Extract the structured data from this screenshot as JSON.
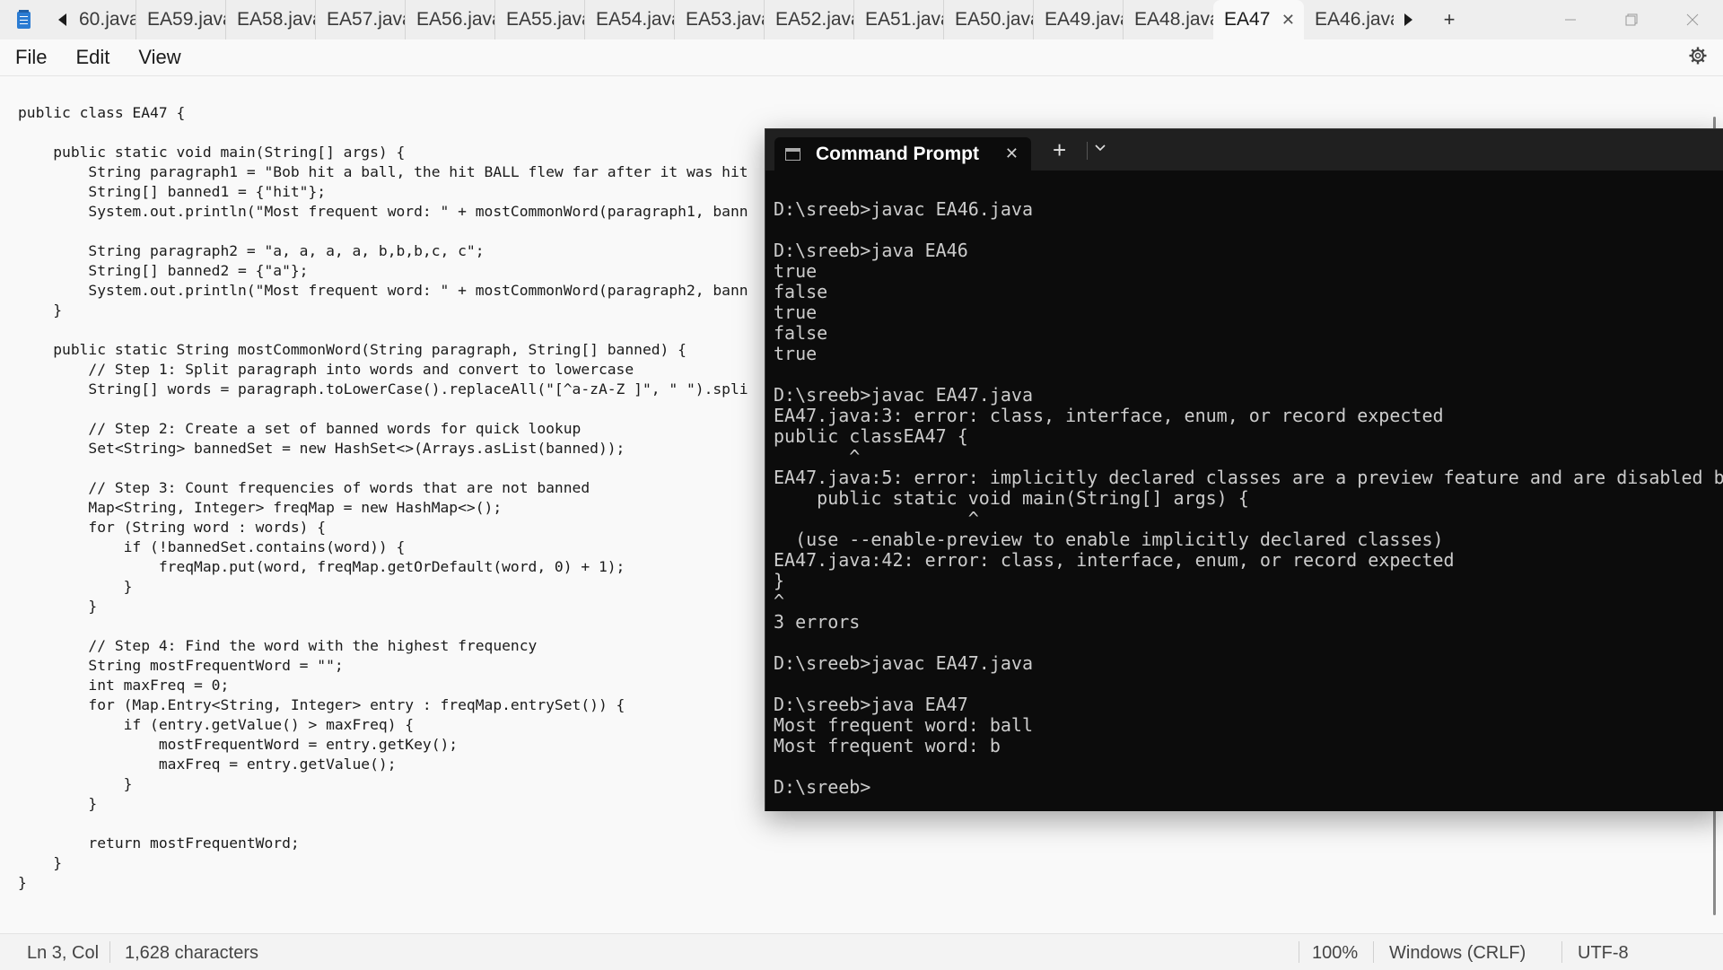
{
  "tabs": {
    "items": [
      "60.java",
      "EA59.java",
      "EA58.java",
      "EA57.java",
      "EA56.java",
      "EA55.java",
      "EA54.java",
      "EA53.java",
      "EA52.java",
      "EA51.java",
      "EA50.java",
      "EA49.java",
      "EA48.java"
    ],
    "active": "EA47",
    "after": "EA46.java",
    "close_glyph": "✕",
    "new_tab_glyph": "+"
  },
  "menu": {
    "file": "File",
    "edit": "Edit",
    "view": "View"
  },
  "editor": {
    "code": "public class EA47 {\n\n    public static void main(String[] args) {\n        String paragraph1 = \"Bob hit a ball, the hit BALL flew far after it was hit\n        String[] banned1 = {\"hit\"};\n        System.out.println(\"Most frequent word: \" + mostCommonWord(paragraph1, bann\n\n        String paragraph2 = \"a, a, a, a, b,b,b,c, c\";\n        String[] banned2 = {\"a\"};\n        System.out.println(\"Most frequent word: \" + mostCommonWord(paragraph2, bann\n    }\n\n    public static String mostCommonWord(String paragraph, String[] banned) {\n        // Step 1: Split paragraph into words and convert to lowercase\n        String[] words = paragraph.toLowerCase().replaceAll(\"[^a-zA-Z ]\", \" \").spli\n\n        // Step 2: Create a set of banned words for quick lookup\n        Set<String> bannedSet = new HashSet<>(Arrays.asList(banned));\n\n        // Step 3: Count frequencies of words that are not banned\n        Map<String, Integer> freqMap = new HashMap<>();\n        for (String word : words) {\n            if (!bannedSet.contains(word)) {\n                freqMap.put(word, freqMap.getOrDefault(word, 0) + 1);\n            }\n        }\n\n        // Step 4: Find the word with the highest frequency\n        String mostFrequentWord = \"\";\n        int maxFreq = 0;\n        for (Map.Entry<String, Integer> entry : freqMap.entrySet()) {\n            if (entry.getValue() > maxFreq) {\n                mostFrequentWord = entry.getKey();\n                maxFreq = entry.getValue();\n            }\n        }\n\n        return mostFrequentWord;\n    }\n}"
  },
  "status": {
    "position": "Ln 3, Col",
    "characters": "1,628 characters",
    "zoom": "100%",
    "line_ending": "Windows (CRLF)",
    "encoding": "UTF-8"
  },
  "terminal": {
    "title": "Command Prompt",
    "close_glyph": "✕",
    "new_tab_glyph": "+",
    "dropdown_glyph": "⌄",
    "output": "D:\\sreeb>javac EA46.java\n\nD:\\sreeb>java EA46\ntrue\nfalse\ntrue\nfalse\ntrue\n\nD:\\sreeb>javac EA47.java\nEA47.java:3: error: class, interface, enum, or record expected\npublic classEA47 {\n       ^\nEA47.java:5: error: implicitly declared classes are a preview feature and are disabled by\n    public static void main(String[] args) {\n                  ^\n  (use --enable-preview to enable implicitly declared classes)\nEA47.java:42: error: class, interface, enum, or record expected\n}\n^\n3 errors\n\nD:\\sreeb>javac EA47.java\n\nD:\\sreeb>java EA47\nMost frequent word: ball\nMost frequent word: b\n\nD:\\sreeb>"
  },
  "colors": {
    "terminal_bg": "#0c0c0c",
    "terminal_text": "#cccccc",
    "editor_bg": "#f9f9f9",
    "tabstrip_bg": "#eeeeee"
  },
  "icons": {
    "notepad": "notepad-app-icon",
    "scroll_left": "caret-left-icon",
    "scroll_right": "caret-right-icon",
    "settings": "gear-icon",
    "minimize": "minimize-icon",
    "maximize": "maximize-icon",
    "close": "close-icon"
  }
}
